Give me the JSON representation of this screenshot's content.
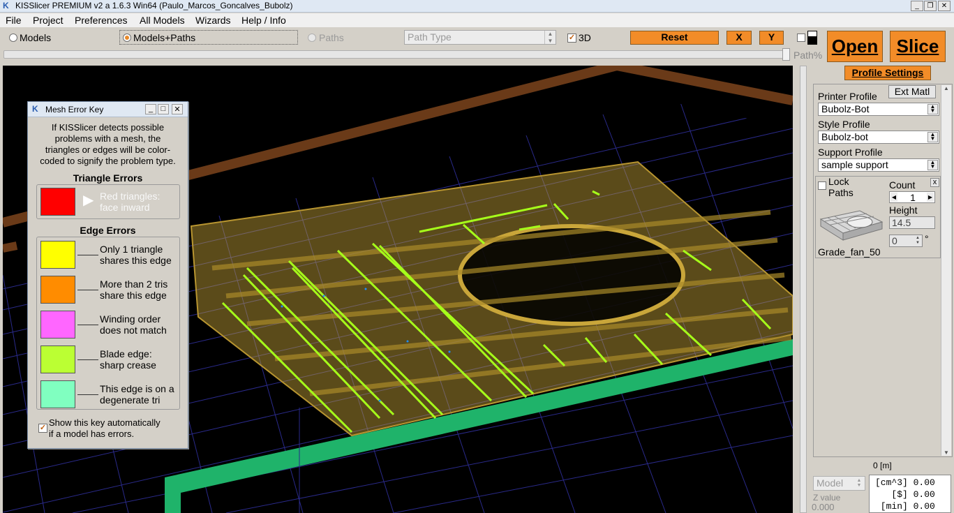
{
  "window": {
    "title": "KISSlicer PREMIUM v2 a 1.6.3 Win64 (Paulo_Marcos_Goncalves_Bubolz)",
    "minimize": "_",
    "restore": "❐",
    "close": "✕"
  },
  "menu": [
    "File",
    "Project",
    "Preferences",
    "All Models",
    "Wizards",
    "Help / Info"
  ],
  "toolbar": {
    "view_models": "Models",
    "view_models_paths": "Models+Paths",
    "view_paths": "Paths",
    "path_type": "Path Type",
    "three_d": "3D",
    "reset": "Reset",
    "x": "X",
    "y": "Y",
    "path_pct": "Path%",
    "open": "Open",
    "slice": "Slice",
    "profile_settings": "Profile Settings"
  },
  "profiles": {
    "ext_matl": "Ext Matl",
    "printer_label": "Printer Profile",
    "printer_value": "Bubolz-Bot",
    "style_label": "Style Profile",
    "style_value": "Bubolz-bot",
    "support_label": "Support Profile",
    "support_value": "sample support"
  },
  "model_card": {
    "lock": "Lock",
    "paths": "Paths",
    "count_label": "Count",
    "count_value": "1",
    "height_label": "Height",
    "height_value": "14.5",
    "rotation_value": "0",
    "degree": "°",
    "name": "Grade_fan_50",
    "close": "x"
  },
  "footer": {
    "time": "0 [m]",
    "model_select": "Model",
    "z_label": "Z value",
    "z_value": "0.000",
    "stats": [
      "[cm^3] 0.00",
      "   [$] 0.00",
      " [min] 0.00"
    ]
  },
  "mesh_key": {
    "title": "Mesh Error Key",
    "intro": [
      "If KISSlicer detects possible",
      "problems with a mesh, the",
      "triangles or edges will be color-",
      "coded to signify the problem type."
    ],
    "triangle_heading": "Triangle Errors",
    "triangle_item": [
      "Red triangles:",
      "face inward"
    ],
    "edge_heading": "Edge Errors",
    "edges": [
      {
        "text1": "Only 1 triangle",
        "text2": "shares this edge",
        "color": "#ffff00"
      },
      {
        "text1": "More than 2 tris",
        "text2": "share this edge",
        "color": "#ff8c00"
      },
      {
        "text1": "Winding order",
        "text2": "does not match",
        "color": "#ff66ff"
      },
      {
        "text1": "Blade edge:",
        "text2": "sharp crease",
        "color": "#bbff33"
      },
      {
        "text1": "This edge is on a",
        "text2": "degenerate tri",
        "color": "#80ffc0"
      }
    ],
    "red_color": "#ff0000",
    "show_key": [
      "Show this key automatically",
      "if a model has errors."
    ]
  }
}
